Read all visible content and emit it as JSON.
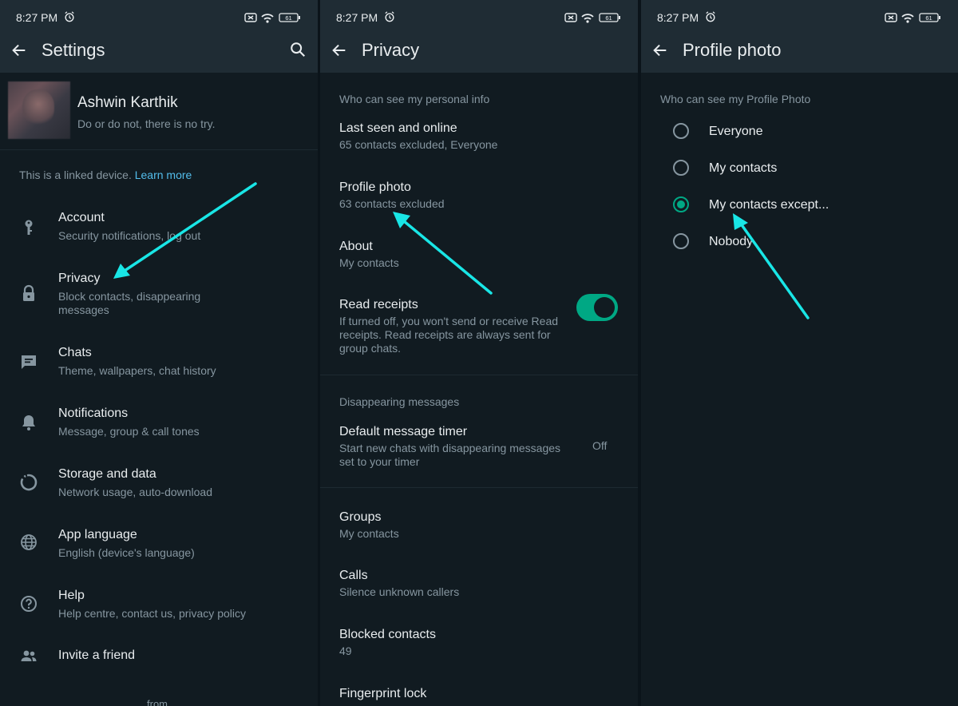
{
  "status": {
    "time": "8:27 PM",
    "battery": "61"
  },
  "settings": {
    "title": "Settings",
    "profile": {
      "name": "Ashwin Karthik",
      "status": "Do or do not, there is no try."
    },
    "linked_text": "This is a linked device.",
    "learn_more": "Learn more",
    "items": [
      {
        "label": "Account",
        "sub": "Security notifications, log out",
        "icon": "key-icon"
      },
      {
        "label": "Privacy",
        "sub": "Block contacts, disappearing messages",
        "icon": "lock-icon"
      },
      {
        "label": "Chats",
        "sub": "Theme, wallpapers, chat history",
        "icon": "chat-icon"
      },
      {
        "label": "Notifications",
        "sub": "Message, group & call tones",
        "icon": "bell-icon"
      },
      {
        "label": "Storage and data",
        "sub": "Network usage, auto-download",
        "icon": "storage-icon"
      },
      {
        "label": "App language",
        "sub": "English (device's language)",
        "icon": "globe-icon"
      },
      {
        "label": "Help",
        "sub": "Help centre, contact us, privacy policy",
        "icon": "help-icon"
      },
      {
        "label": "Invite a friend",
        "sub": "",
        "icon": "people-icon"
      }
    ],
    "from_text": "from"
  },
  "privacy": {
    "title": "Privacy",
    "section1": "Who can see my personal info",
    "items": [
      {
        "label": "Last seen and online",
        "sub": "65 contacts excluded, Everyone"
      },
      {
        "label": "Profile photo",
        "sub": "63 contacts excluded"
      },
      {
        "label": "About",
        "sub": "My contacts"
      },
      {
        "label": "Read receipts",
        "sub": "If turned off, you won't send or receive Read receipts. Read receipts are always sent for group chats."
      }
    ],
    "read_receipts_on": true,
    "section2": "Disappearing messages",
    "timer": {
      "label": "Default message timer",
      "sub": "Start new chats with disappearing messages set to your timer",
      "value": "Off"
    },
    "items2": [
      {
        "label": "Groups",
        "sub": "My contacts"
      },
      {
        "label": "Calls",
        "sub": "Silence unknown callers"
      },
      {
        "label": "Blocked contacts",
        "sub": "49"
      },
      {
        "label": "Fingerprint lock",
        "sub": ""
      }
    ]
  },
  "profile_photo": {
    "title": "Profile photo",
    "heading": "Who can see my Profile Photo",
    "options": [
      {
        "label": "Everyone",
        "selected": false
      },
      {
        "label": "My contacts",
        "selected": false
      },
      {
        "label": "My contacts except...",
        "selected": true
      },
      {
        "label": "Nobody",
        "selected": false
      }
    ]
  },
  "colors": {
    "accent": "#00a884",
    "link": "#53bdeb",
    "annotation_arrow": "#19e6e6"
  }
}
